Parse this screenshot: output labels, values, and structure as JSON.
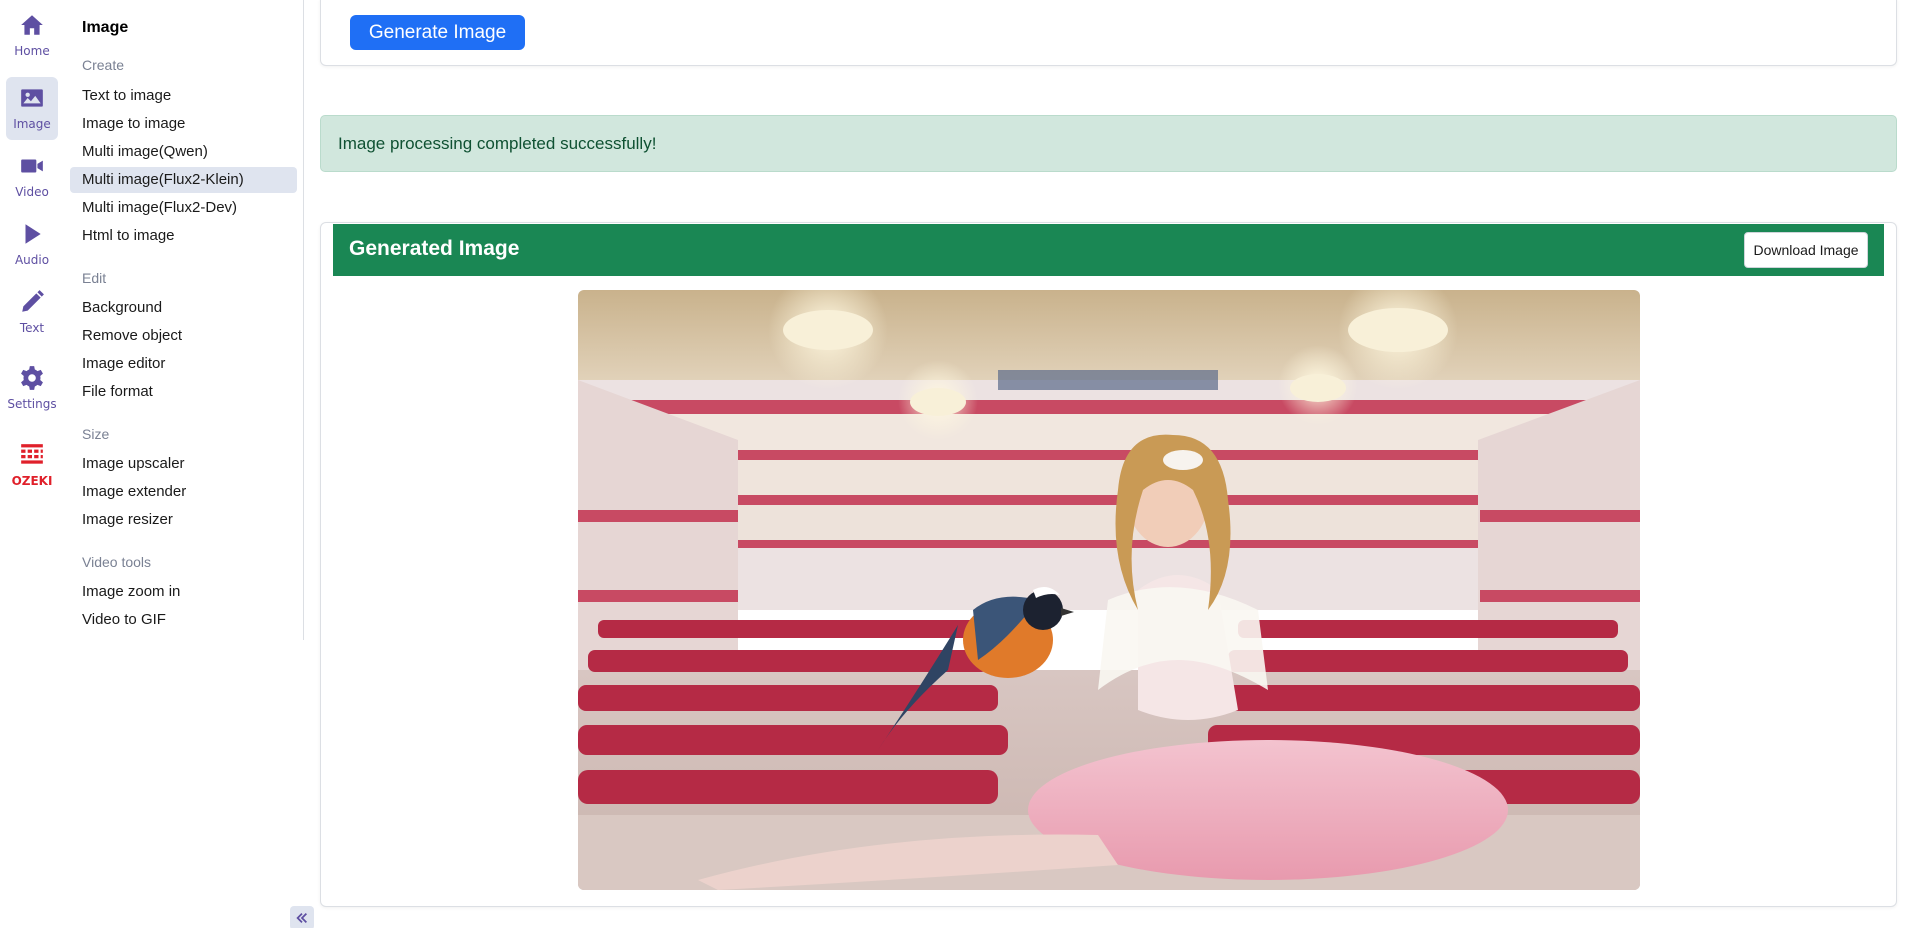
{
  "rail": [
    {
      "label": "Home",
      "icon": "home-icon",
      "active": false
    },
    {
      "label": "Image",
      "icon": "image-icon",
      "active": true
    },
    {
      "label": "Video",
      "icon": "video-icon",
      "active": false
    },
    {
      "label": "Audio",
      "icon": "play-icon",
      "active": false
    },
    {
      "label": "Text",
      "icon": "pencil-icon",
      "active": false
    },
    {
      "label": "Settings",
      "icon": "gear-icon",
      "active": false
    },
    {
      "label": "OZEKI",
      "icon": "ozeki-logo",
      "active": false
    }
  ],
  "submenu": {
    "title": "Image",
    "sections": {
      "create": "Create",
      "edit": "Edit",
      "size": "Size",
      "video_tools": "Video tools"
    },
    "items": {
      "text_to_image": "Text to image",
      "image_to_image": "Image to image",
      "multi_qwen": "Multi image(Qwen)",
      "multi_flux2_klein": "Multi image(Flux2-Klein)",
      "multi_flux2_dev": "Multi image(Flux2-Dev)",
      "html_to_image": "Html to image",
      "background": "Background",
      "remove_object": "Remove object",
      "image_editor": "Image editor",
      "file_format": "File format",
      "image_upscaler": "Image upscaler",
      "image_extender": "Image extender",
      "image_resizer": "Image resizer",
      "image_zoom_in": "Image zoom in",
      "video_to_gif": "Video to GIF"
    },
    "active_item": "multi_flux2_klein"
  },
  "main": {
    "generate_label": "Generate Image",
    "alert_text": "Image processing completed successfully!",
    "result_title": "Generated Image",
    "download_label": "Download Image"
  },
  "colors": {
    "accent": "#5e4fa2",
    "primary": "#1f6ff5",
    "success_header": "#1a8754",
    "alert_bg": "#d1e7dd",
    "ozeki_red": "#e0202a"
  }
}
